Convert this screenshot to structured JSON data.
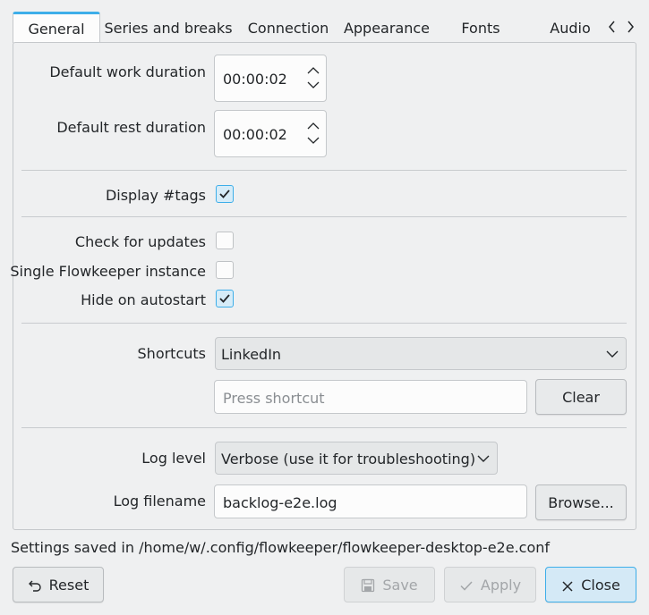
{
  "tabs": [
    {
      "label": "General",
      "active": true
    },
    {
      "label": "Series and breaks"
    },
    {
      "label": "Connection"
    },
    {
      "label": "Appearance"
    },
    {
      "label": "Fonts"
    },
    {
      "label": "Audio"
    }
  ],
  "general": {
    "work_duration_label": "Default work duration",
    "work_duration_value": "00:00:02",
    "rest_duration_label": "Default rest duration",
    "rest_duration_value": "00:00:02",
    "display_tags_label": "Display #tags",
    "display_tags_checked": true,
    "check_updates_label": "Check for updates",
    "check_updates_checked": false,
    "single_instance_label": "Single Flowkeeper instance",
    "single_instance_checked": false,
    "hide_autostart_label": "Hide on autostart",
    "hide_autostart_checked": true,
    "shortcuts_label": "Shortcuts",
    "shortcuts_selected": "LinkedIn",
    "shortcut_placeholder": "Press shortcut",
    "clear_label": "Clear",
    "log_level_label": "Log level",
    "log_level_selected": "Verbose (use it for troubleshooting)",
    "log_filename_label": "Log filename",
    "log_filename_value": "backlog-e2e.log",
    "browse_label": "Browse..."
  },
  "status": "Settings saved in /home/w/.config/flowkeeper/flowkeeper-desktop-e2e.conf",
  "buttons": {
    "reset": "Reset",
    "save": "Save",
    "apply": "Apply",
    "close": "Close"
  },
  "colors": {
    "accent": "#3daee9",
    "window_bg": "#eff0f1",
    "field_bg": "#fcfcfc"
  }
}
